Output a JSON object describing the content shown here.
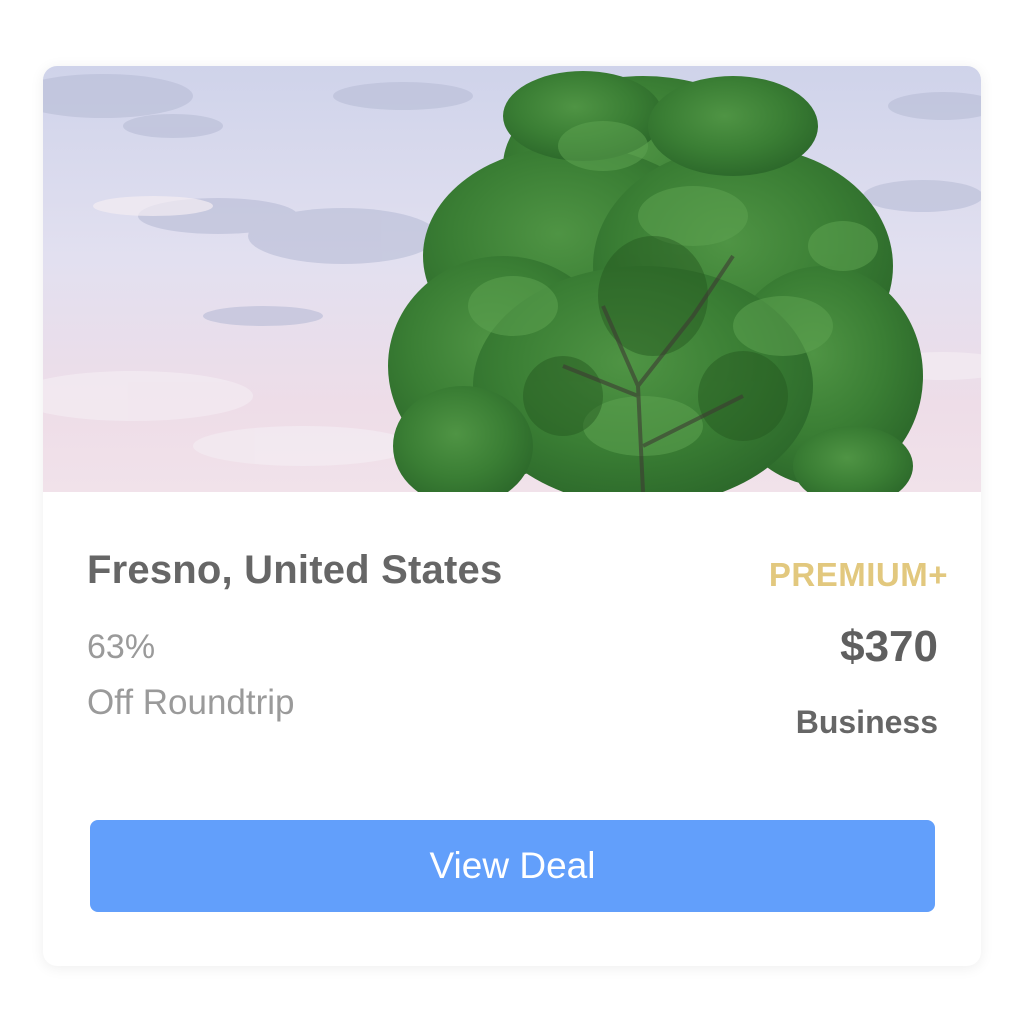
{
  "deal": {
    "destination": "Fresno, United States",
    "tier": "PREMIUM+",
    "discount_percent": "63%",
    "discount_label": "Off Roundtrip",
    "price": "$370",
    "cabin_class": "Business",
    "cta_label": "View Deal"
  },
  "colors": {
    "tier": "#e2c87e",
    "button": "#629ffb",
    "title": "#666666",
    "subtext": "#9a9a9a"
  },
  "image": {
    "subject": "tree-against-sky-photo"
  }
}
